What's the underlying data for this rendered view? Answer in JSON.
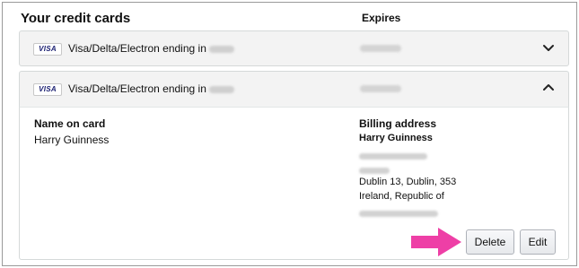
{
  "header": {
    "title": "Your credit cards",
    "expires_label": "Expires"
  },
  "cards": [
    {
      "brand": "VISA",
      "label": "Visa/Delta/Electron  ending in",
      "expanded": false,
      "chevron": "chevron-down-icon"
    },
    {
      "brand": "VISA",
      "label": "Visa/Delta/Electron  ending in",
      "expanded": true,
      "chevron": "chevron-up-icon"
    }
  ],
  "details": {
    "name_on_card_label": "Name on card",
    "name_on_card": "Harry Guinness",
    "billing_address_label": "Billing address",
    "billing_name": "Harry Guinness",
    "address_lines": [
      "Dublin 13, Dublin, 353",
      "Ireland, Republic of"
    ]
  },
  "actions": {
    "delete_label": "Delete",
    "edit_label": "Edit"
  },
  "colors": {
    "annotation_arrow": "#ee3fa6",
    "visa_blue": "#1a1f71",
    "row_background": "#f3f3f3"
  }
}
